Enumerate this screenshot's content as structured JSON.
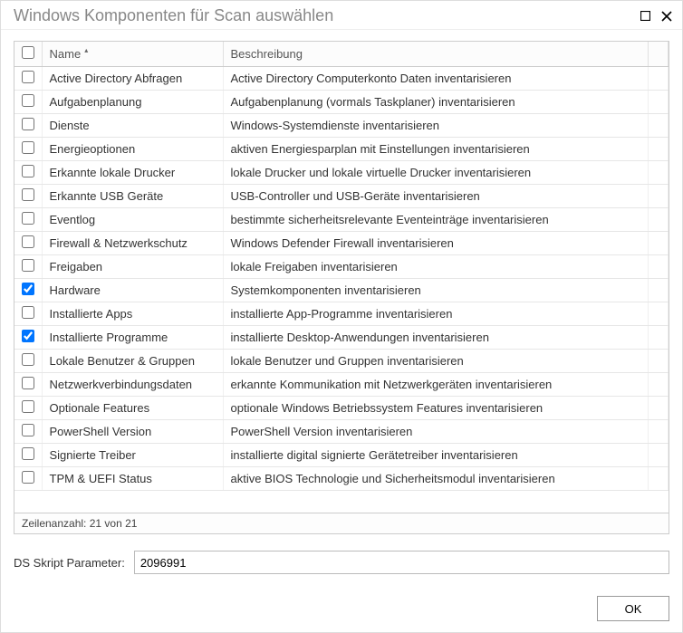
{
  "window": {
    "title": "Windows Komponenten für Scan auswählen"
  },
  "grid": {
    "columns": {
      "name": "Name",
      "desc": "Beschreibung"
    },
    "rows": [
      {
        "checked": false,
        "name": "Active Directory Abfragen",
        "desc": "Active Directory Computerkonto Daten inventarisieren"
      },
      {
        "checked": false,
        "name": "Aufgabenplanung",
        "desc": "Aufgabenplanung (vormals Taskplaner) inventarisieren"
      },
      {
        "checked": false,
        "name": "Dienste",
        "desc": "Windows-Systemdienste inventarisieren"
      },
      {
        "checked": false,
        "name": "Energieoptionen",
        "desc": "aktiven Energiesparplan mit Einstellungen inventarisieren"
      },
      {
        "checked": false,
        "name": "Erkannte lokale Drucker",
        "desc": "lokale Drucker und lokale virtuelle Drucker inventarisieren"
      },
      {
        "checked": false,
        "name": "Erkannte USB Geräte",
        "desc": "USB-Controller und USB-Geräte inventarisieren"
      },
      {
        "checked": false,
        "name": "Eventlog",
        "desc": "bestimmte sicherheitsrelevante Eventeinträge inventarisieren"
      },
      {
        "checked": false,
        "name": "Firewall & Netzwerkschutz",
        "desc": "Windows Defender Firewall inventarisieren"
      },
      {
        "checked": false,
        "name": "Freigaben",
        "desc": "lokale Freigaben inventarisieren"
      },
      {
        "checked": true,
        "name": "Hardware",
        "desc": "Systemkomponenten inventarisieren"
      },
      {
        "checked": false,
        "name": "Installierte Apps",
        "desc": "installierte App-Programme inventarisieren"
      },
      {
        "checked": true,
        "name": "Installierte Programme",
        "desc": "installierte Desktop-Anwendungen inventarisieren"
      },
      {
        "checked": false,
        "name": "Lokale Benutzer & Gruppen",
        "desc": "lokale Benutzer und Gruppen inventarisieren"
      },
      {
        "checked": false,
        "name": "Netzwerkverbindungsdaten",
        "desc": "erkannte Kommunikation mit Netzwerkgeräten inventarisieren"
      },
      {
        "checked": false,
        "name": "Optionale Features",
        "desc": "optionale Windows Betriebssystem Features inventarisieren"
      },
      {
        "checked": false,
        "name": "PowerShell Version",
        "desc": "PowerShell Version inventarisieren"
      },
      {
        "checked": false,
        "name": "Signierte Treiber",
        "desc": "installierte digital signierte Gerätetreiber inventarisieren"
      },
      {
        "checked": false,
        "name": "TPM & UEFI Status",
        "desc": "aktive BIOS Technologie und  Sicherheitsmodul inventarisieren"
      }
    ],
    "status": "Zeilenanzahl: 21 von 21"
  },
  "param": {
    "label": "DS Skript Parameter:",
    "value": "2096991"
  },
  "buttons": {
    "ok": "OK"
  }
}
